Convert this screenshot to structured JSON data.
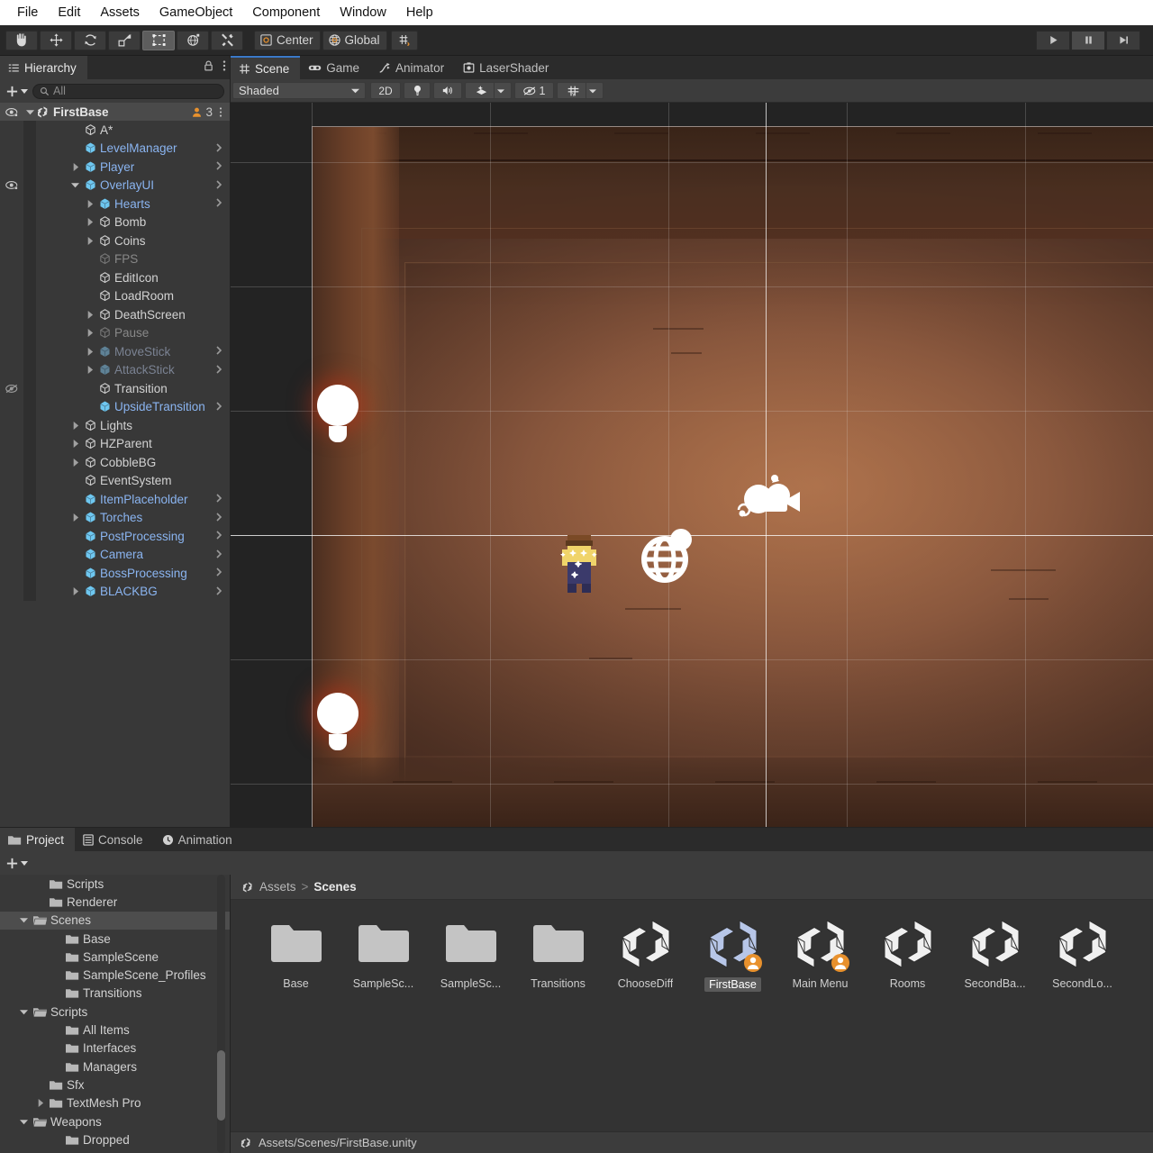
{
  "menubar": {
    "items": [
      "File",
      "Edit",
      "Assets",
      "GameObject",
      "Component",
      "Window",
      "Help"
    ]
  },
  "toolbar": {
    "tools": [
      {
        "name": "hand-tool",
        "icon": "hand-icon",
        "selected": false
      },
      {
        "name": "move-tool",
        "icon": "move-icon",
        "selected": false
      },
      {
        "name": "rotate-tool",
        "icon": "rotate-icon",
        "selected": false
      },
      {
        "name": "scale-tool",
        "icon": "scale-icon",
        "selected": false
      },
      {
        "name": "rect-tool",
        "icon": "rect-icon",
        "selected": true
      },
      {
        "name": "transform-tool",
        "icon": "transform-icon",
        "selected": false
      },
      {
        "name": "custom-tool",
        "icon": "wrench-icon",
        "selected": false
      }
    ],
    "pivot_label": "Center",
    "handle_label": "Global",
    "play_label": "play-icon",
    "pause_label": "pause-icon",
    "step_label": "step-icon"
  },
  "hierarchy": {
    "tab_label": "Hierarchy",
    "search_placeholder": "All",
    "search_value": "",
    "add_label": "+",
    "root": {
      "label": "FirstBase",
      "collab_count": "3",
      "visible": true
    },
    "items": [
      {
        "label": "A*",
        "depth": 2,
        "type": "go",
        "twisty": "none",
        "chev": false,
        "dim": false,
        "eye": "none"
      },
      {
        "label": "LevelManager",
        "depth": 2,
        "type": "prefab",
        "twisty": "none",
        "chev": true,
        "dim": false,
        "eye": "none"
      },
      {
        "label": "Player",
        "depth": 2,
        "type": "prefab",
        "twisty": "closed",
        "chev": true,
        "dim": false,
        "eye": "none"
      },
      {
        "label": "OverlayUI",
        "depth": 2,
        "type": "prefab",
        "twisty": "open",
        "chev": true,
        "dim": false,
        "eye": "visible"
      },
      {
        "label": "Hearts",
        "depth": 3,
        "type": "prefab",
        "twisty": "closed",
        "chev": true,
        "dim": false,
        "eye": "none"
      },
      {
        "label": "Bomb",
        "depth": 3,
        "type": "go",
        "twisty": "closed",
        "chev": false,
        "dim": false,
        "eye": "none"
      },
      {
        "label": "Coins",
        "depth": 3,
        "type": "go",
        "twisty": "closed",
        "chev": false,
        "dim": false,
        "eye": "none"
      },
      {
        "label": "FPS",
        "depth": 3,
        "type": "go",
        "twisty": "none",
        "chev": false,
        "dim": true,
        "eye": "none"
      },
      {
        "label": "EditIcon",
        "depth": 3,
        "type": "go",
        "twisty": "none",
        "chev": false,
        "dim": false,
        "eye": "none"
      },
      {
        "label": "LoadRoom",
        "depth": 3,
        "type": "go",
        "twisty": "none",
        "chev": false,
        "dim": false,
        "eye": "none"
      },
      {
        "label": "DeathScreen",
        "depth": 3,
        "type": "go",
        "twisty": "closed",
        "chev": false,
        "dim": false,
        "eye": "none"
      },
      {
        "label": "Pause",
        "depth": 3,
        "type": "go",
        "twisty": "closed",
        "chev": false,
        "dim": true,
        "eye": "none"
      },
      {
        "label": "MoveStick",
        "depth": 3,
        "type": "prefab",
        "twisty": "closed",
        "chev": true,
        "dim": true,
        "eye": "none"
      },
      {
        "label": "AttackStick",
        "depth": 3,
        "type": "prefab",
        "twisty": "closed",
        "chev": true,
        "dim": true,
        "eye": "none"
      },
      {
        "label": "Transition",
        "depth": 3,
        "type": "go",
        "twisty": "none",
        "chev": false,
        "dim": false,
        "eye": "hidden"
      },
      {
        "label": "UpsideTransition",
        "depth": 3,
        "type": "prefab",
        "twisty": "none",
        "chev": true,
        "dim": false,
        "eye": "none"
      },
      {
        "label": "Lights",
        "depth": 2,
        "type": "go",
        "twisty": "closed",
        "chev": false,
        "dim": false,
        "eye": "none"
      },
      {
        "label": "HZParent",
        "depth": 2,
        "type": "go",
        "twisty": "closed",
        "chev": false,
        "dim": false,
        "eye": "none"
      },
      {
        "label": "CobbleBG",
        "depth": 2,
        "type": "go",
        "twisty": "closed",
        "chev": false,
        "dim": false,
        "eye": "none"
      },
      {
        "label": "EventSystem",
        "depth": 2,
        "type": "go",
        "twisty": "none",
        "chev": false,
        "dim": false,
        "eye": "none"
      },
      {
        "label": "ItemPlaceholder",
        "depth": 2,
        "type": "prefab",
        "twisty": "none",
        "chev": true,
        "dim": false,
        "eye": "none"
      },
      {
        "label": "Torches",
        "depth": 2,
        "type": "prefab",
        "twisty": "closed",
        "chev": true,
        "dim": false,
        "eye": "none"
      },
      {
        "label": "PostProcessing",
        "depth": 2,
        "type": "prefab",
        "twisty": "none",
        "chev": true,
        "dim": false,
        "eye": "none"
      },
      {
        "label": "Camera",
        "depth": 2,
        "type": "prefab",
        "twisty": "none",
        "chev": true,
        "dim": false,
        "eye": "none"
      },
      {
        "label": "BossProcessing",
        "depth": 2,
        "type": "prefab",
        "twisty": "none",
        "chev": true,
        "dim": false,
        "eye": "none"
      },
      {
        "label": "BLACKBG",
        "depth": 2,
        "type": "prefab",
        "twisty": "closed",
        "chev": true,
        "dim": false,
        "eye": "none"
      }
    ]
  },
  "scene_panel": {
    "tabs": [
      {
        "label": "Scene",
        "icon": "grid-icon",
        "active": true
      },
      {
        "label": "Game",
        "icon": "gamepad-icon",
        "active": false
      },
      {
        "label": "Animator",
        "icon": "animator-icon",
        "active": false
      },
      {
        "label": "LaserShader",
        "icon": "shader-icon",
        "active": false
      }
    ],
    "draw_mode": "Shaded",
    "toggle_2d": "2D",
    "lighting_icon": "lightbulb-icon",
    "audio_icon": "speaker-icon",
    "effects_icon": "effects-icon",
    "hidden_count": "1",
    "grid_icon": "grid-visibility-icon"
  },
  "project_panel": {
    "tabs": [
      {
        "label": "Project",
        "icon": "folder-icon",
        "active": true
      },
      {
        "label": "Console",
        "icon": "console-icon",
        "active": false
      },
      {
        "label": "Animation",
        "icon": "clock-icon",
        "active": false
      }
    ],
    "add_label": "+",
    "breadcrumb": [
      "Assets",
      "Scenes"
    ],
    "tree": [
      {
        "label": "Scripts",
        "depth": 2,
        "twisty": "none",
        "open": false,
        "selected": false,
        "clipped": true
      },
      {
        "label": "Renderer",
        "depth": 2,
        "twisty": "none",
        "open": false,
        "selected": false
      },
      {
        "label": "Scenes",
        "depth": 1,
        "twisty": "open",
        "open": true,
        "selected": true
      },
      {
        "label": "Base",
        "depth": 3,
        "twisty": "none",
        "open": false,
        "selected": false
      },
      {
        "label": "SampleScene",
        "depth": 3,
        "twisty": "none",
        "open": false,
        "selected": false
      },
      {
        "label": "SampleScene_Profiles",
        "depth": 3,
        "twisty": "none",
        "open": false,
        "selected": false
      },
      {
        "label": "Transitions",
        "depth": 3,
        "twisty": "none",
        "open": false,
        "selected": false
      },
      {
        "label": "Scripts",
        "depth": 1,
        "twisty": "open",
        "open": true,
        "selected": false
      },
      {
        "label": "All Items",
        "depth": 3,
        "twisty": "none",
        "open": false,
        "selected": false
      },
      {
        "label": "Interfaces",
        "depth": 3,
        "twisty": "none",
        "open": false,
        "selected": false
      },
      {
        "label": "Managers",
        "depth": 3,
        "twisty": "none",
        "open": false,
        "selected": false
      },
      {
        "label": "Sfx",
        "depth": 2,
        "twisty": "none",
        "open": false,
        "selected": false
      },
      {
        "label": "TextMesh Pro",
        "depth": 2,
        "twisty": "closed",
        "open": false,
        "selected": false
      },
      {
        "label": "Weapons",
        "depth": 1,
        "twisty": "open",
        "open": true,
        "selected": false
      },
      {
        "label": "Dropped",
        "depth": 3,
        "twisty": "none",
        "open": false,
        "selected": false,
        "clipped": true
      }
    ],
    "assets": [
      {
        "label": "Base",
        "kind": "folder",
        "selected": false,
        "badge": false
      },
      {
        "label": "SampleSc...",
        "kind": "folder",
        "selected": false,
        "badge": false
      },
      {
        "label": "SampleSc...",
        "kind": "folder",
        "selected": false,
        "badge": false
      },
      {
        "label": "Transitions",
        "kind": "folder",
        "selected": false,
        "badge": false
      },
      {
        "label": "ChooseDiff",
        "kind": "scene",
        "selected": false,
        "badge": false
      },
      {
        "label": "FirstBase",
        "kind": "scene",
        "selected": true,
        "badge": true
      },
      {
        "label": "Main Menu",
        "kind": "scene",
        "selected": false,
        "badge": true
      },
      {
        "label": "Rooms",
        "kind": "scene",
        "selected": false,
        "badge": false
      },
      {
        "label": "SecondBa...",
        "kind": "scene",
        "selected": false,
        "badge": false
      },
      {
        "label": "SecondLo...",
        "kind": "scene",
        "selected": false,
        "badge": false
      }
    ],
    "status_path": "Assets/Scenes/FirstBase.unity"
  },
  "colors": {
    "accent_blue": "#3a79c8",
    "prefab_blue": "#8ab4f0",
    "collab_orange": "#e8912d",
    "panel_bg": "#383838",
    "tab_bg": "#2b2b2b",
    "selection": "#4d4d4d"
  }
}
